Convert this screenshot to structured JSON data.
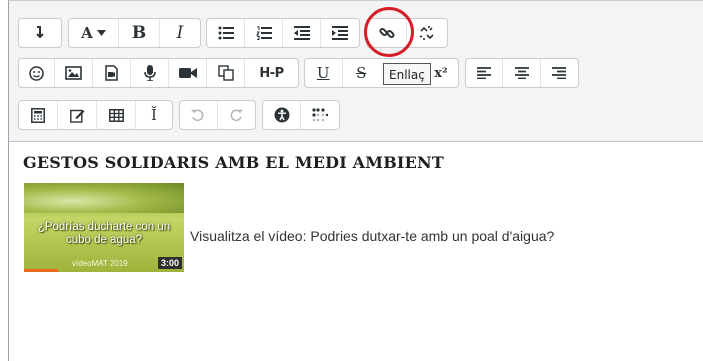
{
  "toolbar": {
    "row1": {
      "expand_icon": "arrow-down-icon",
      "font_color_label": "A",
      "bold_label": "B",
      "italic_label": "I",
      "unordered_list_icon": "unordered-list-icon",
      "ordered_list_icon": "ordered-list-icon",
      "outdent_icon": "outdent-icon",
      "indent_icon": "indent-icon",
      "link_icon": "link-icon",
      "unlink_icon": "unlink-icon"
    },
    "row2": {
      "emoji_icon": "smiley-icon",
      "image_icon": "image-icon",
      "media_icon": "media-file-icon",
      "record_audio_icon": "microphone-icon",
      "record_video_icon": "video-camera-icon",
      "manage_files_icon": "copy-files-icon",
      "h5p_label": "H-P",
      "underline_label": "U",
      "strikethrough_label": "S",
      "superscript_label": "x²",
      "align_left_icon": "align-left-icon",
      "align_center_icon": "align-center-icon",
      "align_right_icon": "align-right-icon"
    },
    "row3": {
      "equation_icon": "calculator-icon",
      "edit_icon": "edit-icon",
      "table_icon": "table-icon",
      "clear_format_label": "Ĭ",
      "undo_icon": "undo-icon",
      "redo_icon": "redo-icon",
      "accessibility_icon": "accessibility-icon",
      "screenreader_icon": "braille-icon"
    }
  },
  "tooltip": {
    "text": "Enllaç"
  },
  "content": {
    "heading": "GESTOS SOLIDARIS AMB EL MEDI AMBIENT",
    "thumbnail": {
      "question": "¿Podrías ducharte con un cubo de agua?",
      "brand": "vídeoMAT 2019",
      "duration": "3:00"
    },
    "link_text": "Visualitza el vídeo: Podries dutxar-te amb un poal d'aigua?"
  },
  "colors": {
    "highlight_circle": "#d61e27",
    "toolbar_bg": "#f4f4f4",
    "progress_bar": "#e8681c"
  }
}
